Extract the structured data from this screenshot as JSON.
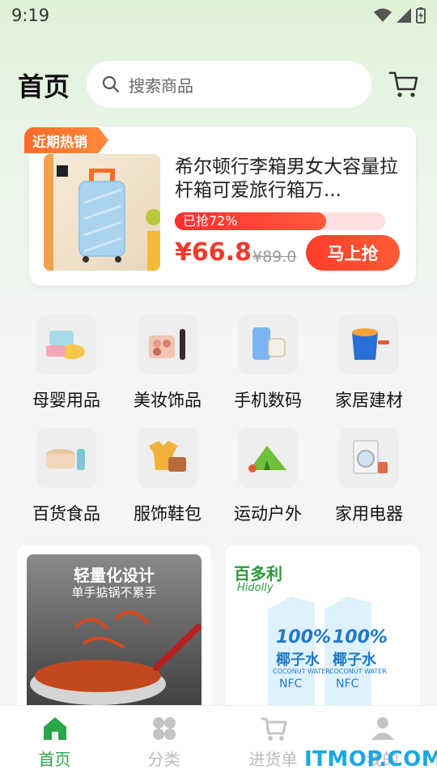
{
  "status": {
    "time": "9:19"
  },
  "header": {
    "title": "首页",
    "search_placeholder": "搜索商品"
  },
  "promo": {
    "tag": "近期热销",
    "product_name": "希尔顿行李箱男女大容量拉杆箱可爱旅行箱万...",
    "progress_label": "已抢72%",
    "progress_percent": 72,
    "price": "¥66.8",
    "original_price": "¥89.0",
    "buy_label": "马上抢"
  },
  "categories": [
    {
      "label": "母婴用品",
      "icon": "baby-products-icon"
    },
    {
      "label": "美妆饰品",
      "icon": "cosmetics-icon"
    },
    {
      "label": "手机数码",
      "icon": "phone-digital-icon"
    },
    {
      "label": "家居建材",
      "icon": "home-building-icon"
    },
    {
      "label": "百货食品",
      "icon": "grocery-food-icon"
    },
    {
      "label": "服饰鞋包",
      "icon": "clothing-bags-icon"
    },
    {
      "label": "运动户外",
      "icon": "sports-outdoor-icon"
    },
    {
      "label": "家用电器",
      "icon": "home-appliance-icon"
    }
  ],
  "cards": [
    {
      "headline": "轻量化设计",
      "subline": "单手掂锅不累手"
    },
    {
      "brand": "百多利",
      "brand_sub": "Hidolly",
      "badge1": "100%",
      "badge2": "椰子水",
      "badge3": "COCONUT WATER",
      "badge4": "NFC"
    }
  ],
  "tabbar": [
    {
      "label": "首页",
      "active": true
    },
    {
      "label": "分类",
      "active": false
    },
    {
      "label": "进货单",
      "active": false
    },
    {
      "label": "我的",
      "active": false
    }
  ],
  "watermark": "ITMOP.COM",
  "colors": {
    "accent": "#2aa54a",
    "sale": "#f23a2a",
    "tag": "#ff6a2a"
  }
}
